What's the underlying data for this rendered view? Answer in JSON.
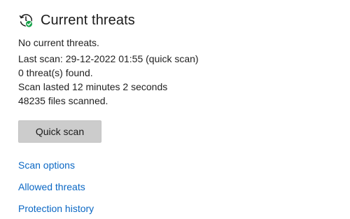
{
  "section": {
    "icon": "history-clock-checkmark-icon",
    "title": "Current threats",
    "status": "No current threats.",
    "details": [
      "Last scan: 29-12-2022 01:55 (quick scan)",
      "0 threat(s) found.",
      "Scan lasted 12 minutes 2 seconds",
      "48235 files scanned."
    ],
    "quick_scan_label": "Quick scan",
    "links": {
      "scan_options": "Scan options",
      "allowed_threats": "Allowed threats",
      "protection_history": "Protection history"
    }
  },
  "colors": {
    "link": "#0a67c4",
    "button_bg": "#cccccc",
    "icon_check": "#16a34a",
    "text": "#1a1a1a"
  }
}
